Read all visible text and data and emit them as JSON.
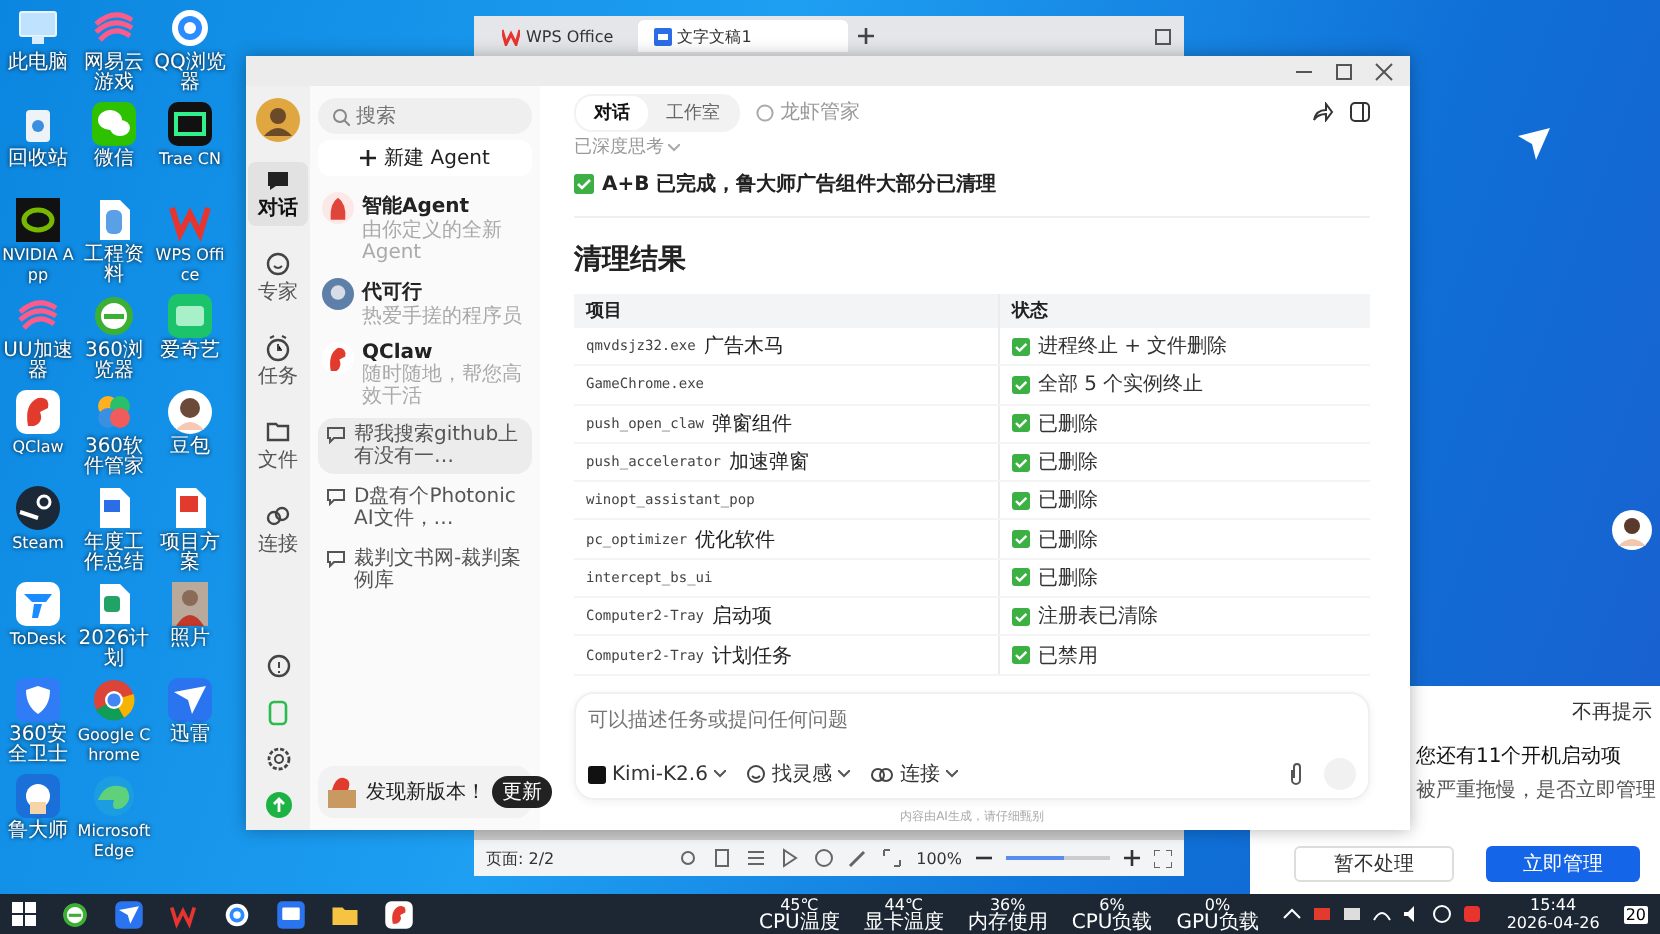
{
  "desktop_icons": [
    {
      "label": "此电脑",
      "kind": "monitor"
    },
    {
      "label": "网易云游戏",
      "kind": "swirl"
    },
    {
      "label": "QQ浏览器",
      "kind": "cloud"
    },
    {
      "label": "回收站",
      "kind": "bin"
    },
    {
      "label": "微信",
      "kind": "chat"
    },
    {
      "label": "Trae CN",
      "kind": "trae"
    },
    {
      "label": "NVIDIA App",
      "kind": "nvidia"
    },
    {
      "label": "工程资料",
      "kind": "file"
    },
    {
      "label": "WPS Office",
      "kind": "wps"
    },
    {
      "label": "UU加速器",
      "kind": "swirl"
    },
    {
      "label": "360浏览器",
      "kind": "ebrowser"
    },
    {
      "label": "爱奇艺",
      "kind": "iqiyi"
    },
    {
      "label": "QClaw",
      "kind": "claw"
    },
    {
      "label": "360软件管家",
      "kind": "flower"
    },
    {
      "label": "豆包",
      "kind": "avatar"
    },
    {
      "label": "Steam",
      "kind": "steam"
    },
    {
      "label": "年度工作总结",
      "kind": "word"
    },
    {
      "label": "项目方案",
      "kind": "pdf"
    },
    {
      "label": "ToDesk",
      "kind": "todesk"
    },
    {
      "label": "2026计划",
      "kind": "excel"
    },
    {
      "label": "照片",
      "kind": "photo"
    },
    {
      "label": "360安全卫士",
      "kind": "shield"
    },
    {
      "label": "Google Chrome",
      "kind": "chrome"
    },
    {
      "label": "迅雷",
      "kind": "bird"
    },
    {
      "label": "鲁大师",
      "kind": "ludashi"
    },
    {
      "label": "Microsoft Edge",
      "kind": "edge"
    }
  ],
  "wps_window": {
    "tabs": [
      {
        "label": "WPS Office",
        "selected": false
      },
      {
        "label": "文字文稿1",
        "selected": true
      }
    ],
    "page": "页面: 2/2",
    "zoom": "100%",
    "zoom_slider": {
      "level": 0.55
    }
  },
  "app": {
    "nav": [
      {
        "label": "对话",
        "selected": true
      },
      {
        "label": "专家",
        "selected": false
      },
      {
        "label": "任务",
        "selected": false
      },
      {
        "label": "文件",
        "selected": false
      },
      {
        "label": "连接",
        "selected": false
      }
    ],
    "search": {
      "placeholder": "搜索"
    },
    "new_agent": "新建 Agent",
    "agents": [
      {
        "name": "智能Agent",
        "description": "由你定义的全新Agent"
      },
      {
        "name": "代可行",
        "description": "热爱手搓的程序员"
      },
      {
        "name": "QClaw",
        "description": "随时随地，帮您高效干活"
      }
    ],
    "chats": [
      {
        "title": "帮我搜索github上有没有一…",
        "selected": true
      },
      {
        "title": "D盘有个Photonic AI文件，…",
        "selected": false
      },
      {
        "title": "裁判文书网-裁判案例库",
        "selected": false
      }
    ],
    "update": {
      "text": "发现新版本！",
      "button": "更新"
    },
    "mode_tabs": [
      {
        "label": "对话",
        "selected": true
      },
      {
        "label": "工作室",
        "selected": false
      }
    ],
    "assistant": "龙虾管家",
    "thinking": "已深度思考",
    "summary": "A+B 已完成，鲁大师广告组件大部分已清理",
    "heading": "清理结果",
    "table": {
      "columns": [
        "项目",
        "状态"
      ],
      "rows": [
        {
          "code": "qmvdsjz32.exe",
          "note": "广告木马",
          "status": "进程终止 + 文件删除"
        },
        {
          "code": "GameChrome.exe",
          "status": "全部 5 个实例终止"
        },
        {
          "code": "push_open_claw",
          "note": "弹窗组件",
          "status": "已删除"
        },
        {
          "code": "push_accelerator",
          "note": "加速弹窗",
          "status": "已删除"
        },
        {
          "code": "winopt_assistant_pop",
          "status": "已删除"
        },
        {
          "code": "pc_optimizer",
          "note": "优化软件",
          "status": "已删除"
        },
        {
          "code": "intercept_bs_ui",
          "status": "已删除"
        },
        {
          "code": "Computer2-Tray",
          "note": "启动项",
          "status": "注册表已清除"
        },
        {
          "code": "Computer2-Tray",
          "note": "计划任务",
          "status": "已禁用"
        }
      ]
    },
    "input": {
      "placeholder": "可以描述任务或提问任何问题"
    },
    "model": "Kimi-K2.6",
    "inspire": "找灵感",
    "connect": "连接",
    "disclaimer": "内容由AI生成，请仔细甄别"
  },
  "notification": {
    "dismiss": "不再提示",
    "message": "您还有11个开机启动项",
    "detail": "被严重拖慢，是否立即管理",
    "buttons": [
      {
        "label": "暂不处理",
        "primary": false
      },
      {
        "label": "立即管理",
        "primary": true
      }
    ]
  },
  "taskbar": {
    "apps": [
      {
        "kind": "ebrowser"
      },
      {
        "kind": "bird"
      },
      {
        "kind": "wps"
      },
      {
        "kind": "cloud"
      },
      {
        "kind": "remote"
      },
      {
        "kind": "folder"
      },
      {
        "kind": "claw"
      }
    ],
    "sensors": [
      {
        "value": "45℃",
        "label": "CPU温度"
      },
      {
        "value": "44℃",
        "label": "显卡温度"
      },
      {
        "value": "36%",
        "label": "内存使用"
      },
      {
        "value": "6%",
        "label": "CPU负载"
      },
      {
        "value": "0%",
        "label": "GPU负载"
      }
    ],
    "time": "15:44",
    "date": "2026-04-26",
    "badge": "20"
  }
}
